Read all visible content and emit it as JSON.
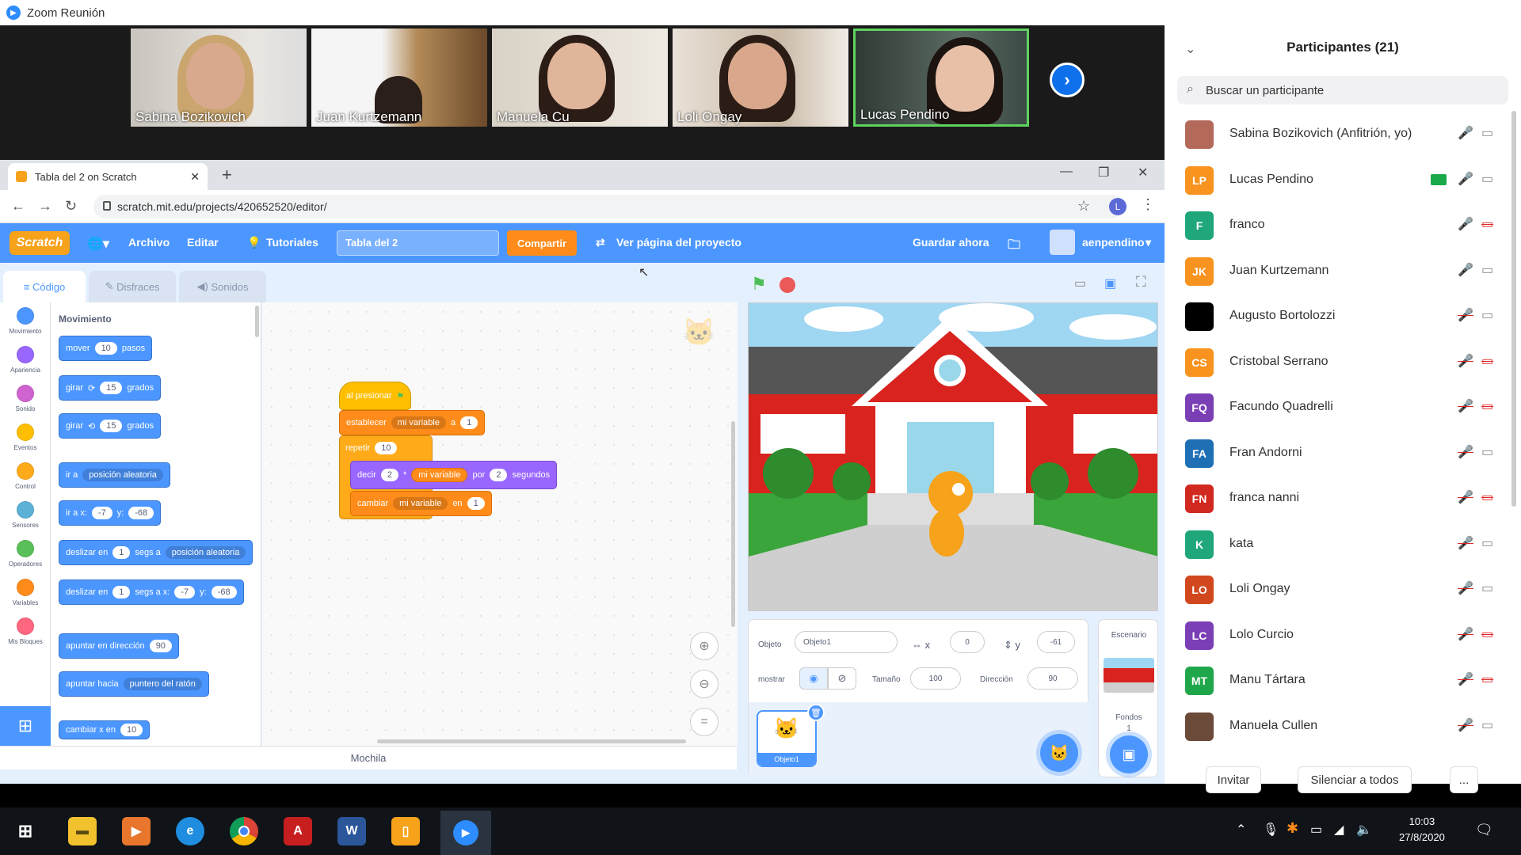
{
  "zoom": {
    "window_title": "Zoom Reunión",
    "gallery": [
      {
        "name": "Sabina Bozikovich"
      },
      {
        "name": "Juan Kurtzemann"
      },
      {
        "name": "Manuela Cu"
      },
      {
        "name": "Loli Ongay"
      },
      {
        "name": "Lucas Pendino"
      }
    ]
  },
  "browser": {
    "tab_title": "Tabla del 2 on Scratch",
    "url": "scratch.mit.edu/projects/420652520/editor/",
    "profile_letter": "L"
  },
  "scratch": {
    "menu": {
      "logo": "Scratch",
      "archivo": "Archivo",
      "editar": "Editar",
      "tutoriales": "Tutoriales",
      "project_title": "Tabla del 2",
      "share": "Compartir",
      "view_page": "Ver página del proyecto",
      "save_now": "Guardar ahora",
      "username": "aenpendino"
    },
    "tabs": {
      "code": "Código",
      "costumes": "Disfraces",
      "sounds": "Sonidos"
    },
    "categories": [
      {
        "label": "Movimiento",
        "color": "#4c97ff"
      },
      {
        "label": "Apariencia",
        "color": "#9966ff"
      },
      {
        "label": "Sonido",
        "color": "#cf63cf"
      },
      {
        "label": "Eventos",
        "color": "#ffbf00"
      },
      {
        "label": "Control",
        "color": "#ffab19"
      },
      {
        "label": "Sensores",
        "color": "#5cb1d6"
      },
      {
        "label": "Operadores",
        "color": "#59c059"
      },
      {
        "label": "Variables",
        "color": "#ff8c1a"
      },
      {
        "label": "Mis Bloques",
        "color": "#ff6680"
      }
    ],
    "palette": {
      "heading": "Movimiento",
      "mover": "mover",
      "mover_val": "10",
      "pasos": "pasos",
      "girar": "girar",
      "girar_val": "15",
      "grados": "grados",
      "ir_a": "ir a",
      "posicion_aleatoria": "posición aleatoria",
      "ir_a_x": "ir a x:",
      "x_val": "-7",
      "y_lbl": "y:",
      "y_val": "-68",
      "deslizar_en": "deslizar en",
      "uno": "1",
      "segs_a": "segs a",
      "segs_a_x": "segs a x:",
      "apuntar_dir": "apuntar en dirección",
      "dir_val": "90",
      "apuntar_hacia": "apuntar hacia",
      "puntero": "puntero del ratón",
      "cambiar_x": "cambiar x en",
      "cambiar_x_val": "10"
    },
    "script": {
      "al_presionar": "al presionar",
      "establecer": "establecer",
      "mi_variable": "mi variable",
      "a": "a",
      "val_1": "1",
      "repetir": "repetir",
      "repetir_val": "10",
      "decir": "decir",
      "dos": "2",
      "por": "*",
      "por_lbl": "por",
      "segundos": "segundos",
      "cambiar": "cambiar",
      "en": "en"
    },
    "backpack": "Mochila",
    "sprite_info": {
      "objeto_lbl": "Objeto",
      "objeto": "Objeto1",
      "x": "0",
      "y": "-61",
      "mostrar": "mostrar",
      "tamano_lbl": "Tamaño",
      "tamano": "100",
      "direccion_lbl": "Dirección",
      "direccion": "90",
      "sprite_thumb": "Objeto1"
    },
    "stage_pane": {
      "escenario": "Escenario",
      "fondos_lbl": "Fondos",
      "fondos": "1"
    }
  },
  "participants": {
    "title": "Participantes (21)",
    "search_placeholder": "Buscar un participante",
    "list": [
      {
        "name": "Sabina Bozikovich (Anfitrión, yo)",
        "initials": "",
        "color": "#b46a5a",
        "muted": false,
        "video": true
      },
      {
        "name": "Lucas Pendino",
        "initials": "LP",
        "color": "#f7931e",
        "muted": false,
        "video": true
      },
      {
        "name": "franco",
        "initials": "F",
        "color": "#1fa67a",
        "muted": false,
        "video": false
      },
      {
        "name": "Juan Kurtzemann",
        "initials": "JK",
        "color": "#f7931e",
        "muted": false,
        "video": true
      },
      {
        "name": "Augusto Bortolozzi",
        "initials": "",
        "color": "#000000",
        "muted": true,
        "video": true
      },
      {
        "name": "Cristobal Serrano",
        "initials": "CS",
        "color": "#f7931e",
        "muted": true,
        "video": false
      },
      {
        "name": "Facundo Quadrelli",
        "initials": "FQ",
        "color": "#7b3fb5",
        "muted": true,
        "video": false
      },
      {
        "name": "Fran Andorni",
        "initials": "FA",
        "color": "#1f6fb5",
        "muted": true,
        "video": true
      },
      {
        "name": "franca nanni",
        "initials": "FN",
        "color": "#d1281f",
        "muted": true,
        "video": false
      },
      {
        "name": "kata",
        "initials": "K",
        "color": "#1fa67a",
        "muted": true,
        "video": true
      },
      {
        "name": "Loli Ongay",
        "initials": "LO",
        "color": "#d1481f",
        "muted": true,
        "video": true
      },
      {
        "name": "Lolo Curcio",
        "initials": "LC",
        "color": "#7b3fb5",
        "muted": true,
        "video": false
      },
      {
        "name": "Manu Tártara",
        "initials": "MT",
        "color": "#1fa64a",
        "muted": true,
        "video": false
      },
      {
        "name": "Manuela Cullen",
        "initials": "",
        "color": "#6b4a3a",
        "muted": true,
        "video": true
      }
    ],
    "invite": "Invitar",
    "mute_all": "Silenciar a todos",
    "more": "..."
  },
  "taskbar": {
    "time": "10:03",
    "date": "27/8/2020"
  }
}
